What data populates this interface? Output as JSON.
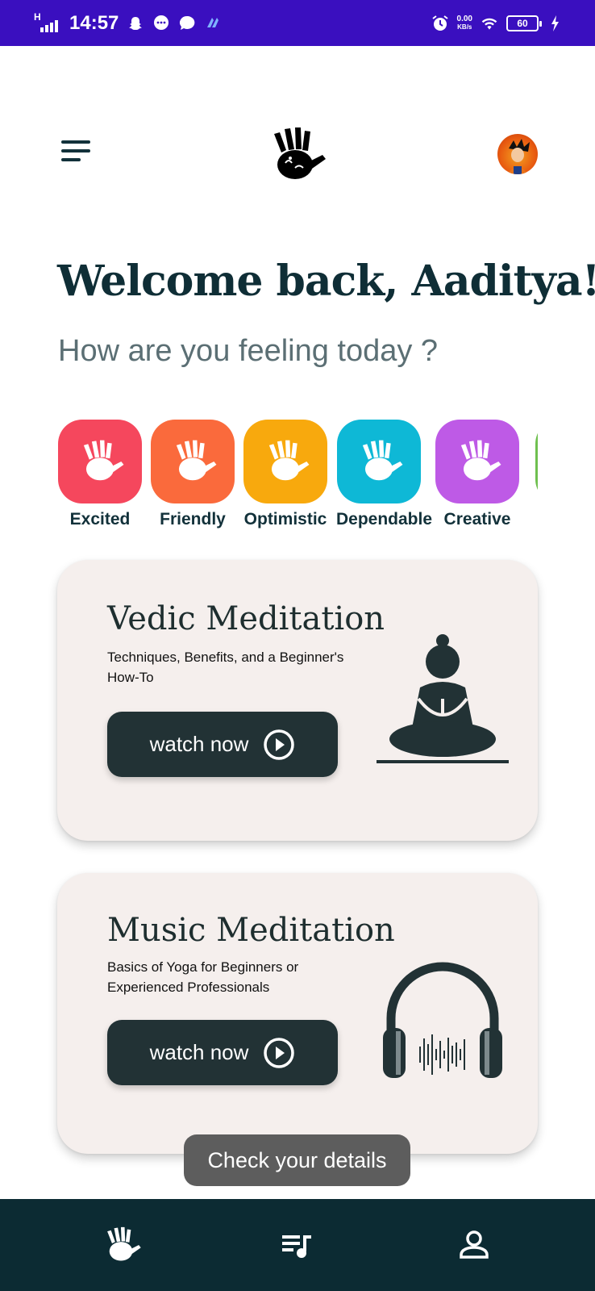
{
  "status_bar": {
    "time": "14:57",
    "network_type": "H",
    "data_speed_value": "0.00",
    "data_speed_unit": "KB/s",
    "battery_level": "60"
  },
  "header": {
    "menu_icon": "hamburger-menu-icon",
    "logo_icon": "handprint-logo-icon",
    "avatar_icon": "profile-avatar"
  },
  "welcome": {
    "title": "Welcome back, Aaditya!",
    "subtitle": "How are you feeling today ?"
  },
  "moods": [
    {
      "label": "Excited",
      "color": "#f5475d"
    },
    {
      "label": "Friendly",
      "color": "#fa6a3c"
    },
    {
      "label": "Optimistic",
      "color": "#f8a90d"
    },
    {
      "label": "Dependable",
      "color": "#0eb8d6"
    },
    {
      "label": "Creative",
      "color": "#be5ae6"
    },
    {
      "label": "",
      "color": "#6fc04f"
    }
  ],
  "cards": [
    {
      "title": "Vedic Meditation",
      "subtitle": "Techniques, Benefits, and a Beginner's How-To",
      "button_label": "watch now",
      "art_icon": "meditating-person-icon"
    },
    {
      "title": "Music Meditation",
      "subtitle": "Basics of Yoga for Beginners or Experienced Professionals",
      "button_label": "watch now",
      "art_icon": "headphones-icon"
    }
  ],
  "toast": {
    "message": "Check your details"
  },
  "bottom_nav": [
    {
      "icon": "hand-icon",
      "name": "home"
    },
    {
      "icon": "playlist-music-icon",
      "name": "playlist"
    },
    {
      "icon": "person-icon",
      "name": "profile"
    }
  ],
  "colors": {
    "status_bar": "#3a0fbf",
    "primary_dark": "#0c2b33",
    "card_bg": "#f5efed",
    "button_bg": "#223235"
  }
}
